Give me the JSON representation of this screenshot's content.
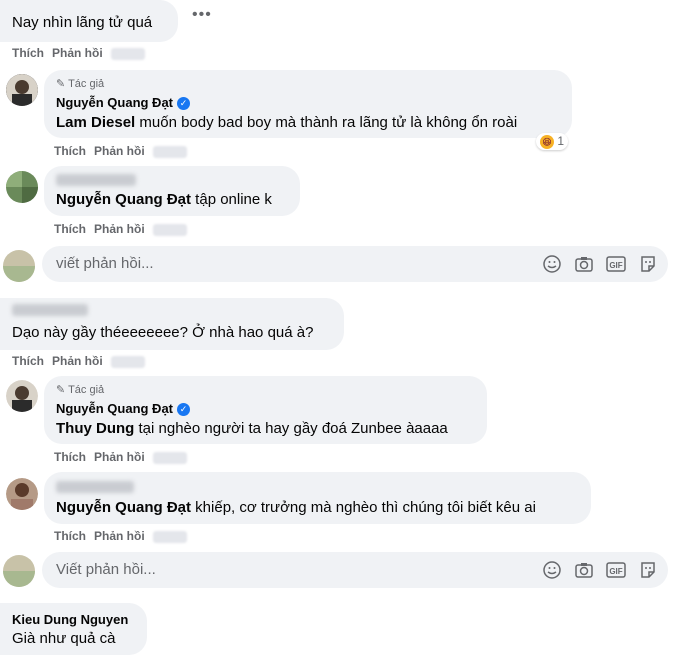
{
  "labels": {
    "like": "Thích",
    "reply": "Phản hồi",
    "author": "Tác giả"
  },
  "comments": [
    {
      "text": "Nay nhìn lãng tử quá"
    },
    {
      "author_name": "Nguyễn Quang Đạt",
      "mention": "Lam Diesel",
      "text": " muốn body bad boy mà thành ra lãng tử là không ổn roài",
      "reaction_count": "1"
    },
    {
      "author_name": "Nguyễn Quang Đạt",
      "mention": "Nguyễn Quang Đạt",
      "text": " tập online k"
    },
    {
      "text": "Dạo này gầy théeeeeeee? Ở nhà hao quá à?"
    },
    {
      "author_name": "Nguyễn Quang Đạt",
      "mention": "Thuy Dung",
      "text": " tại nghèo người ta hay gầy đoá Zunbee àaaaa"
    },
    {
      "mention": "Nguyễn Quang Đạt",
      "text": " khiếp, cơ trưởng mà nghèo thì chúng tôi biết kêu ai"
    },
    {
      "author_name": "Kieu Dung Nguyen",
      "text": "Già như quả cà"
    }
  ],
  "reply_input": {
    "placeholder_1": "viết phản hồi...",
    "placeholder_2": "Viết phản hồi..."
  },
  "colors": {
    "bubble": "#f0f2f5",
    "secondary_text": "#65676b",
    "verified": "#1877f2"
  }
}
